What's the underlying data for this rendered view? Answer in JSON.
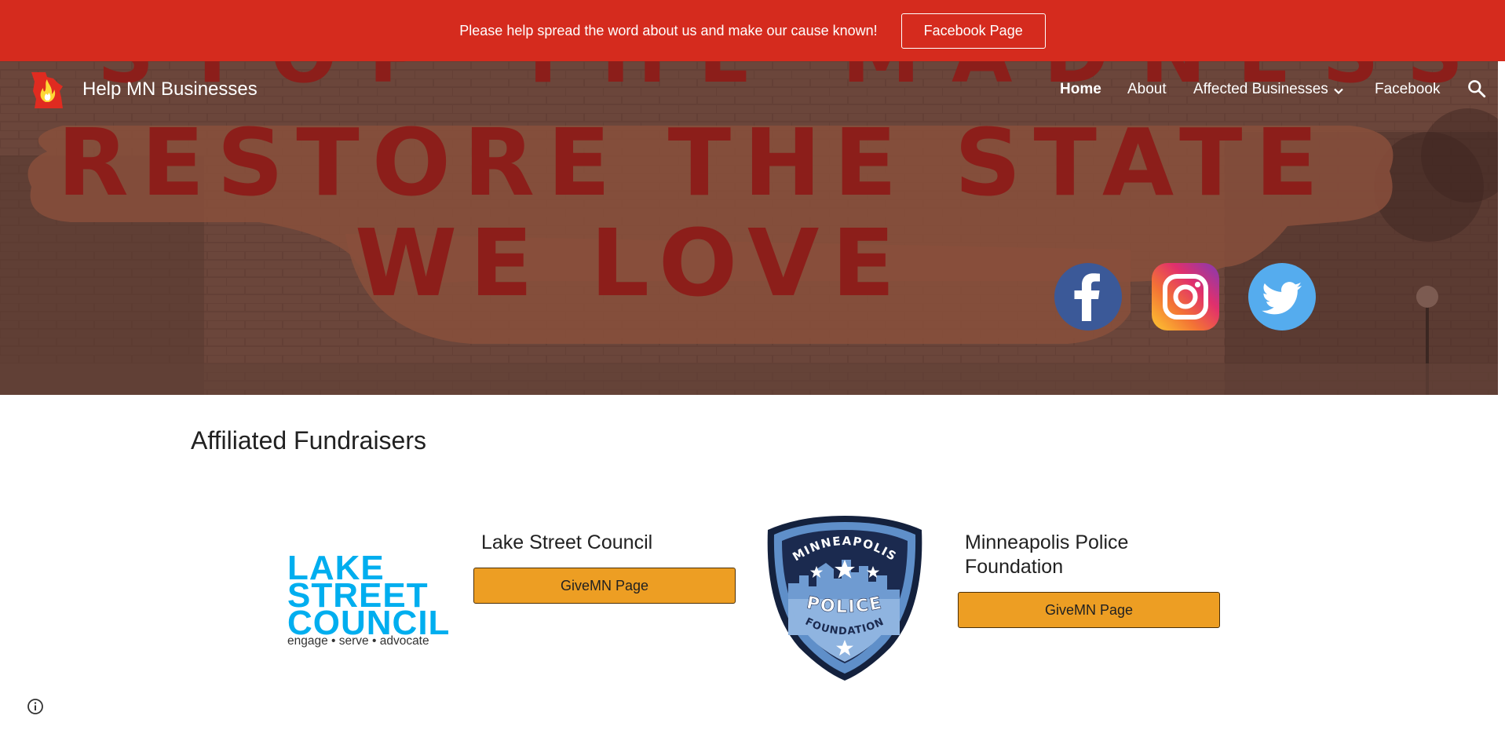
{
  "announcement": {
    "text": "Please help spread the word about us and make our cause known!",
    "button_label": "Facebook Page",
    "bg_color": "#d52b1e"
  },
  "site": {
    "title": "Help MN Businesses",
    "logo_icon": "minnesota-flame-logo-icon"
  },
  "nav": {
    "items": [
      {
        "label": "Home",
        "active": true
      },
      {
        "label": "About"
      },
      {
        "label": "Affected Businesses",
        "has_dropdown": true
      },
      {
        "label": "Facebook"
      }
    ],
    "search_icon": "search-icon"
  },
  "hero": {
    "lines": [
      "STOP THE MADNESS",
      "RESTORE THE STATE",
      "WE LOVE"
    ],
    "social_icons": [
      "facebook-icon",
      "instagram-icon",
      "twitter-icon"
    ]
  },
  "main": {
    "section_title": "Affiliated Fundraisers",
    "fundraisers": [
      {
        "name": "Lake Street Council",
        "button_label": "GiveMN Page",
        "logo": {
          "lines": [
            "LAKE",
            "STREET",
            "COUNCIL"
          ],
          "tagline": "engage • serve • advocate"
        }
      },
      {
        "name": "Minneapolis Police Foundation",
        "button_label": "GiveMN Page",
        "logo": {
          "top_text": "MINNEAPOLIS",
          "middle_text": "POLICE",
          "bottom_text": "FOUNDATION"
        }
      }
    ]
  },
  "colors": {
    "accent_button": "#ed9e23",
    "lake_street_blue": "#00aeef",
    "badge_navy": "#1b2a4f"
  },
  "footer": {
    "info_icon": "info-icon"
  }
}
